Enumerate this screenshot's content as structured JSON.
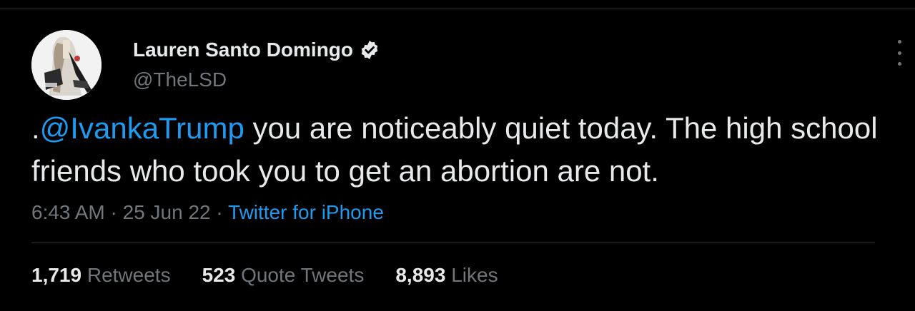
{
  "colors": {
    "background": "#000000",
    "text": "#e7e9ea",
    "muted": "#71767b",
    "accent": "#1d9bf0",
    "divider": "#2f3336"
  },
  "author": {
    "name": "Lauren Santo Domingo",
    "handle": "@TheLSD",
    "verified": true,
    "avatar_icon": "profile-photo"
  },
  "tweet": {
    "prefix": ".",
    "mention": "@IvankaTrump",
    "text": " you are noticeably quiet today. The high school friends who took you to get an abortion are not."
  },
  "meta": {
    "time": "6:43 AM",
    "separator1": " · ",
    "date": "25 Jun 22",
    "separator2": " · ",
    "source": "Twitter for iPhone"
  },
  "stats": [
    {
      "count": "1,719",
      "label": "Retweets"
    },
    {
      "count": "523",
      "label": "Quote Tweets"
    },
    {
      "count": "8,893",
      "label": "Likes"
    }
  ],
  "icons": {
    "verified": "verified-badge-icon",
    "more": "more-options-icon"
  }
}
